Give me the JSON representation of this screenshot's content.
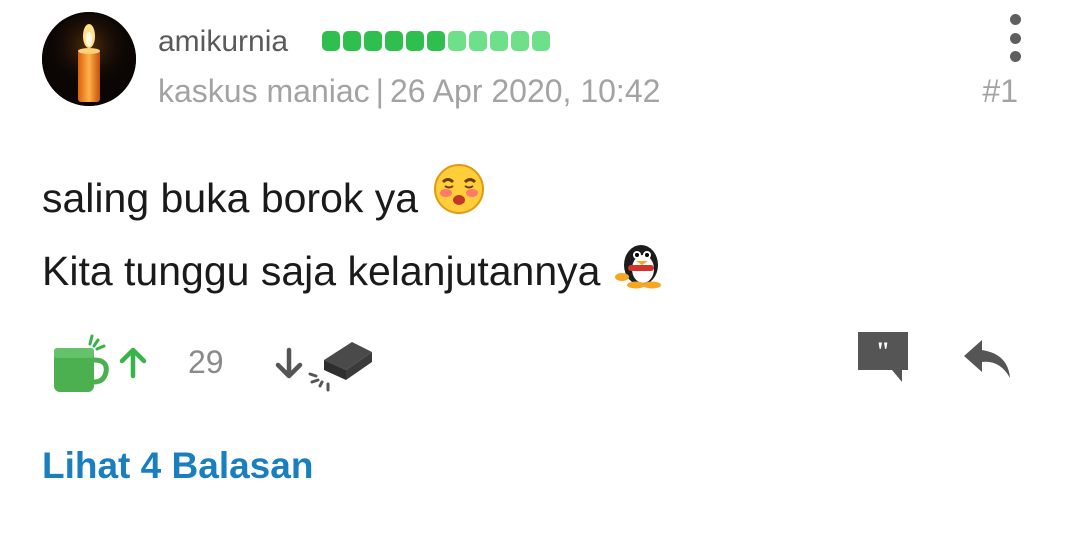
{
  "post": {
    "username": "amikurnia",
    "reputation": {
      "filled": 6,
      "total": 11,
      "filled_color": "#2fbf4f",
      "empty_color": "#6fe08a"
    },
    "rank": "kaskus maniac",
    "separator": "|",
    "timestamp": "26 Apr 2020, 10:42",
    "number": "#1",
    "avatar_icon": "candle-icon",
    "lines": [
      {
        "text": "saling buka borok ya",
        "emoticon": "blushing-face-emoticon"
      },
      {
        "text": "Kita tunggu saja kelanjutannya",
        "emoticon": "penguin-emoticon"
      }
    ]
  },
  "actions": {
    "cendol_icon": "cendol-cup-icon",
    "upvote_icon": "arrow-up-icon",
    "vote_count": "29",
    "downvote_icon": "arrow-down-icon",
    "bata_icon": "brick-icon",
    "quote_icon": "quote-bubble-icon",
    "reply_icon": "reply-arrow-icon",
    "accent_green": "#37b34a"
  },
  "replies_link": "Lihat 4 Balasan"
}
